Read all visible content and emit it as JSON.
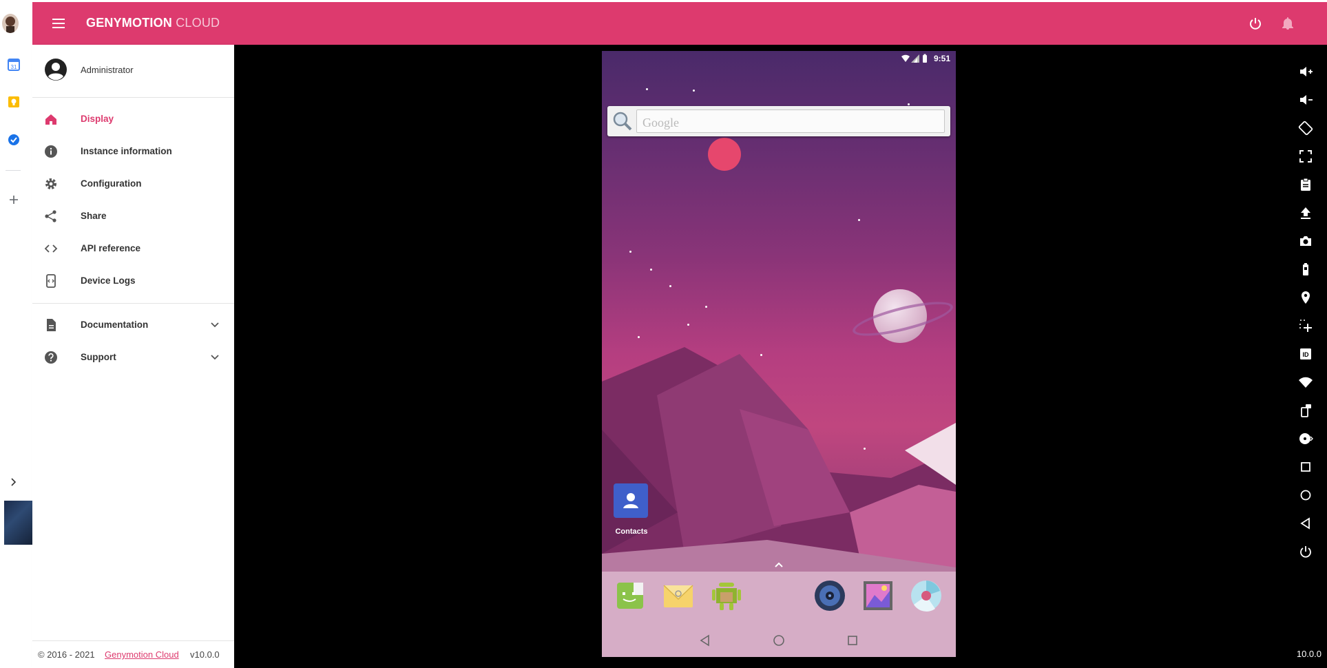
{
  "side_strip": {
    "items": [
      "avatar",
      "calendar-app-icon",
      "keep-app-icon",
      "tasks-app-icon",
      "add-icon",
      "expand-panel-icon"
    ]
  },
  "header": {
    "brand_bold": "GENYMOTION",
    "brand_light": " CLOUD",
    "accent_color": "#dd3a6e"
  },
  "sidebar": {
    "user": "Administrator",
    "nav": [
      {
        "label": "Display",
        "icon": "home-icon",
        "active": true
      },
      {
        "label": "Instance information",
        "icon": "info-icon"
      },
      {
        "label": "Configuration",
        "icon": "gear-icon"
      },
      {
        "label": "Share",
        "icon": "share-icon"
      },
      {
        "label": "API reference",
        "icon": "code-icon"
      },
      {
        "label": "Device Logs",
        "icon": "logs-icon"
      }
    ],
    "secondary": [
      {
        "label": "Documentation",
        "icon": "document-icon"
      },
      {
        "label": "Support",
        "icon": "help-icon"
      }
    ],
    "footer": {
      "copyright": "© 2016 - 2021",
      "link": "Genymotion Cloud",
      "version": "v10.0.0"
    }
  },
  "device": {
    "time": "9:51",
    "search_placeholder": "Google",
    "contacts_label": "Contacts",
    "dock_apps": [
      "messaging-app-icon",
      "email-app-icon",
      "android-app-icon",
      "music-app-icon",
      "gallery-app-icon",
      "camera-app-icon"
    ]
  },
  "toolbar": {
    "items": [
      "volume-up-icon",
      "volume-down-icon",
      "rotate-icon",
      "fullscreen-icon",
      "clipboard-icon",
      "upload-icon",
      "camera-icon",
      "battery-icon",
      "gps-icon",
      "multitouch-icon",
      "device-id-icon",
      "wifi-icon",
      "phone-icon",
      "disk-io-icon",
      "recent-apps-icon",
      "home-icon",
      "back-icon",
      "power-icon"
    ]
  },
  "version_badge": "10.0.0"
}
